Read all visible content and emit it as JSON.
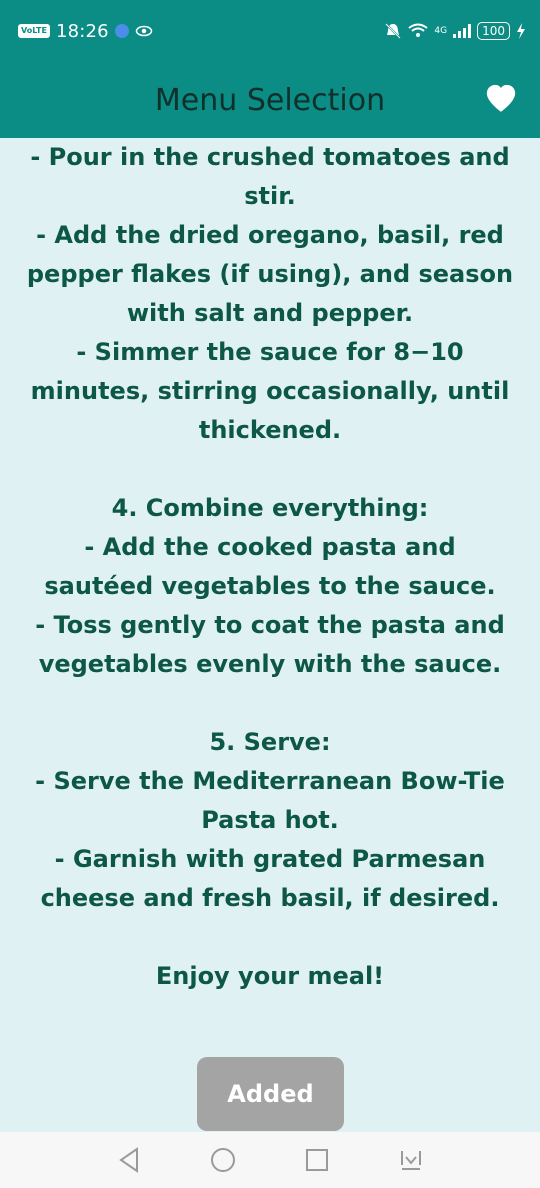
{
  "status_bar": {
    "volte": "VoLTE",
    "time": "18:26",
    "network": "4G",
    "battery": "100"
  },
  "app_bar": {
    "title": "Menu Selection",
    "favorite_icon": "heart-icon"
  },
  "recipe": {
    "lines": [
      "- Pour in the crushed tomatoes and",
      "stir.",
      "- Add the dried oregano, basil, red",
      "pepper flakes (if using), and season",
      "with salt and pepper.",
      "- Simmer the sauce for 8−10",
      "minutes, stirring occasionally, until",
      "thickened.",
      "",
      "4. Combine everything:",
      "- Add the cooked pasta and",
      "sautéed vegetables to the sauce.",
      "- Toss gently to coat the pasta and",
      "vegetables evenly with the sauce.",
      "",
      "5. Serve:",
      "- Serve the Mediterranean Bow-Tie",
      "Pasta hot.",
      "- Garnish with grated Parmesan",
      "cheese and fresh basil, if desired.",
      "",
      "Enjoy your meal!"
    ]
  },
  "added_button": {
    "label": "Added"
  },
  "nav_bar": {
    "back_icon": "back-triangle-icon",
    "home_icon": "home-circle-icon",
    "recents_icon": "recents-square-icon",
    "extra_icon": "download-icon"
  },
  "colors": {
    "primary": "#0b8c84",
    "background": "#dff1f2",
    "text": "#0d5746",
    "button_disabled": "#a4a4a4"
  }
}
